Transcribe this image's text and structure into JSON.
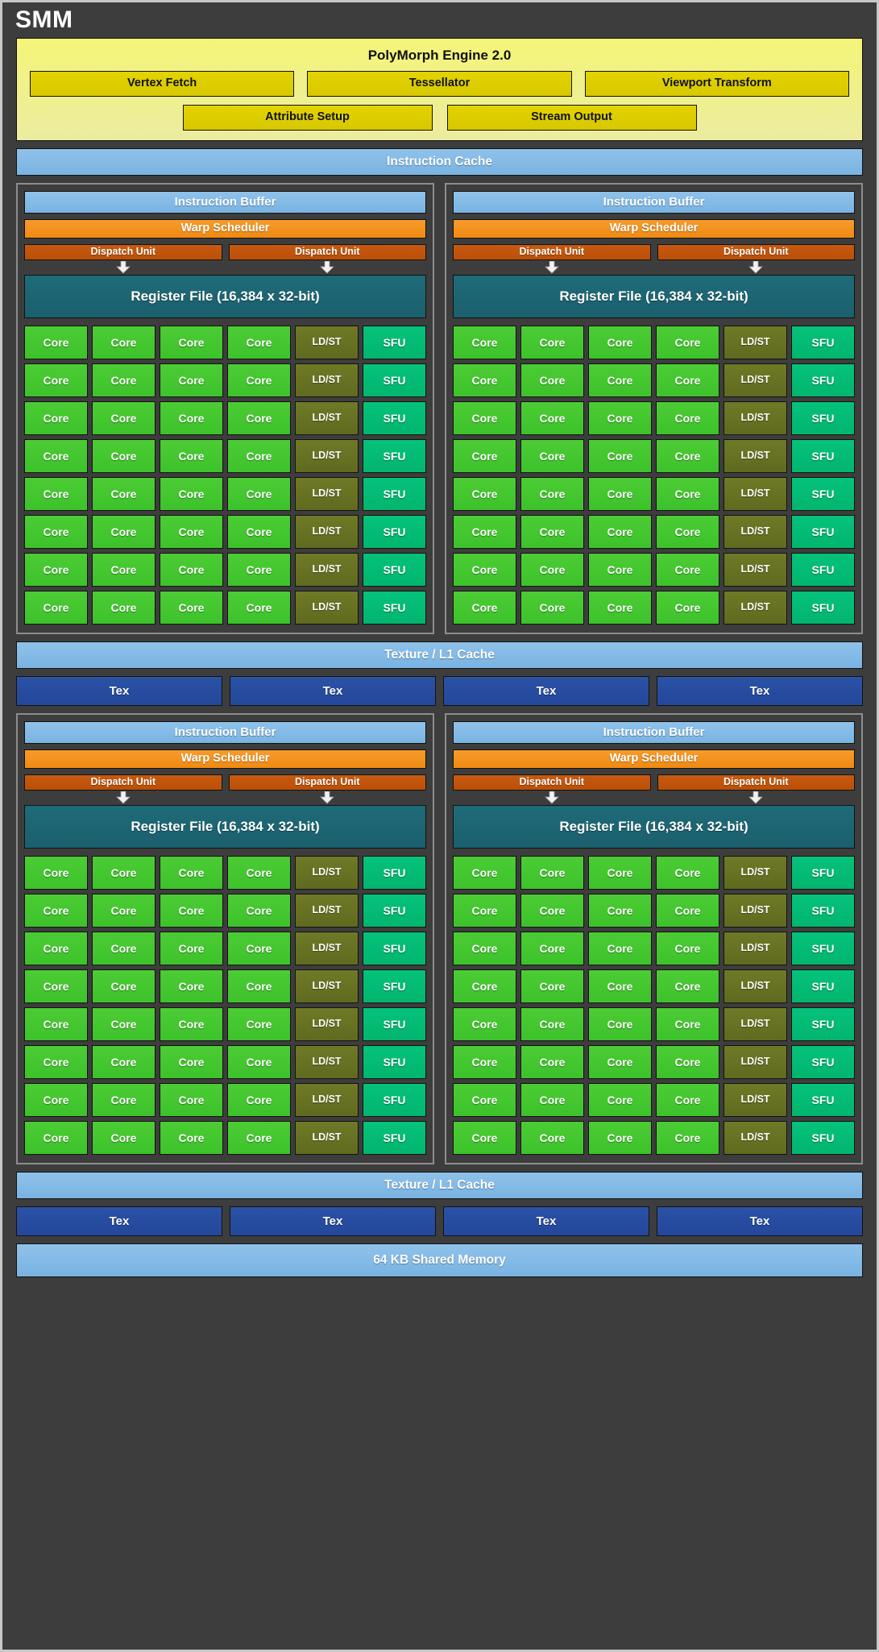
{
  "title": "SMM",
  "polymorph": {
    "title": "PolyMorph Engine 2.0",
    "row1": [
      "Vertex Fetch",
      "Tessellator",
      "Viewport Transform"
    ],
    "row2": [
      "Attribute Setup",
      "Stream Output"
    ]
  },
  "instruction_cache": "Instruction Cache",
  "processing_block": {
    "instruction_buffer": "Instruction Buffer",
    "warp_scheduler": "Warp Scheduler",
    "dispatch_units": [
      "Dispatch Unit",
      "Dispatch Unit"
    ],
    "register_file": "Register File (16,384 x 32-bit)",
    "core_label": "Core",
    "ldst_label": "LD/ST",
    "sfu_label": "SFU",
    "core_rows": 8,
    "cores_per_row": 4,
    "arrow_icon": "down-arrow-icon"
  },
  "texture_cache": "Texture / L1 Cache",
  "tex_label": "Tex",
  "tex_count": 4,
  "shared_memory": "64 KB Shared Memory",
  "colors": {
    "background": "#3d3d3d",
    "polymorph_fill": "#f4f578",
    "polymorph_cell": "#e3d300",
    "cache_blue": "#8fc2ea",
    "warp_orange": "#f79b2c",
    "dispatch_orange": "#c75a10",
    "register_teal": "#1f6b79",
    "core_green": "#4ccc34",
    "ldst_olive": "#6f7a27",
    "sfu_green": "#05c27a",
    "tex_blue": "#2a52a5"
  }
}
